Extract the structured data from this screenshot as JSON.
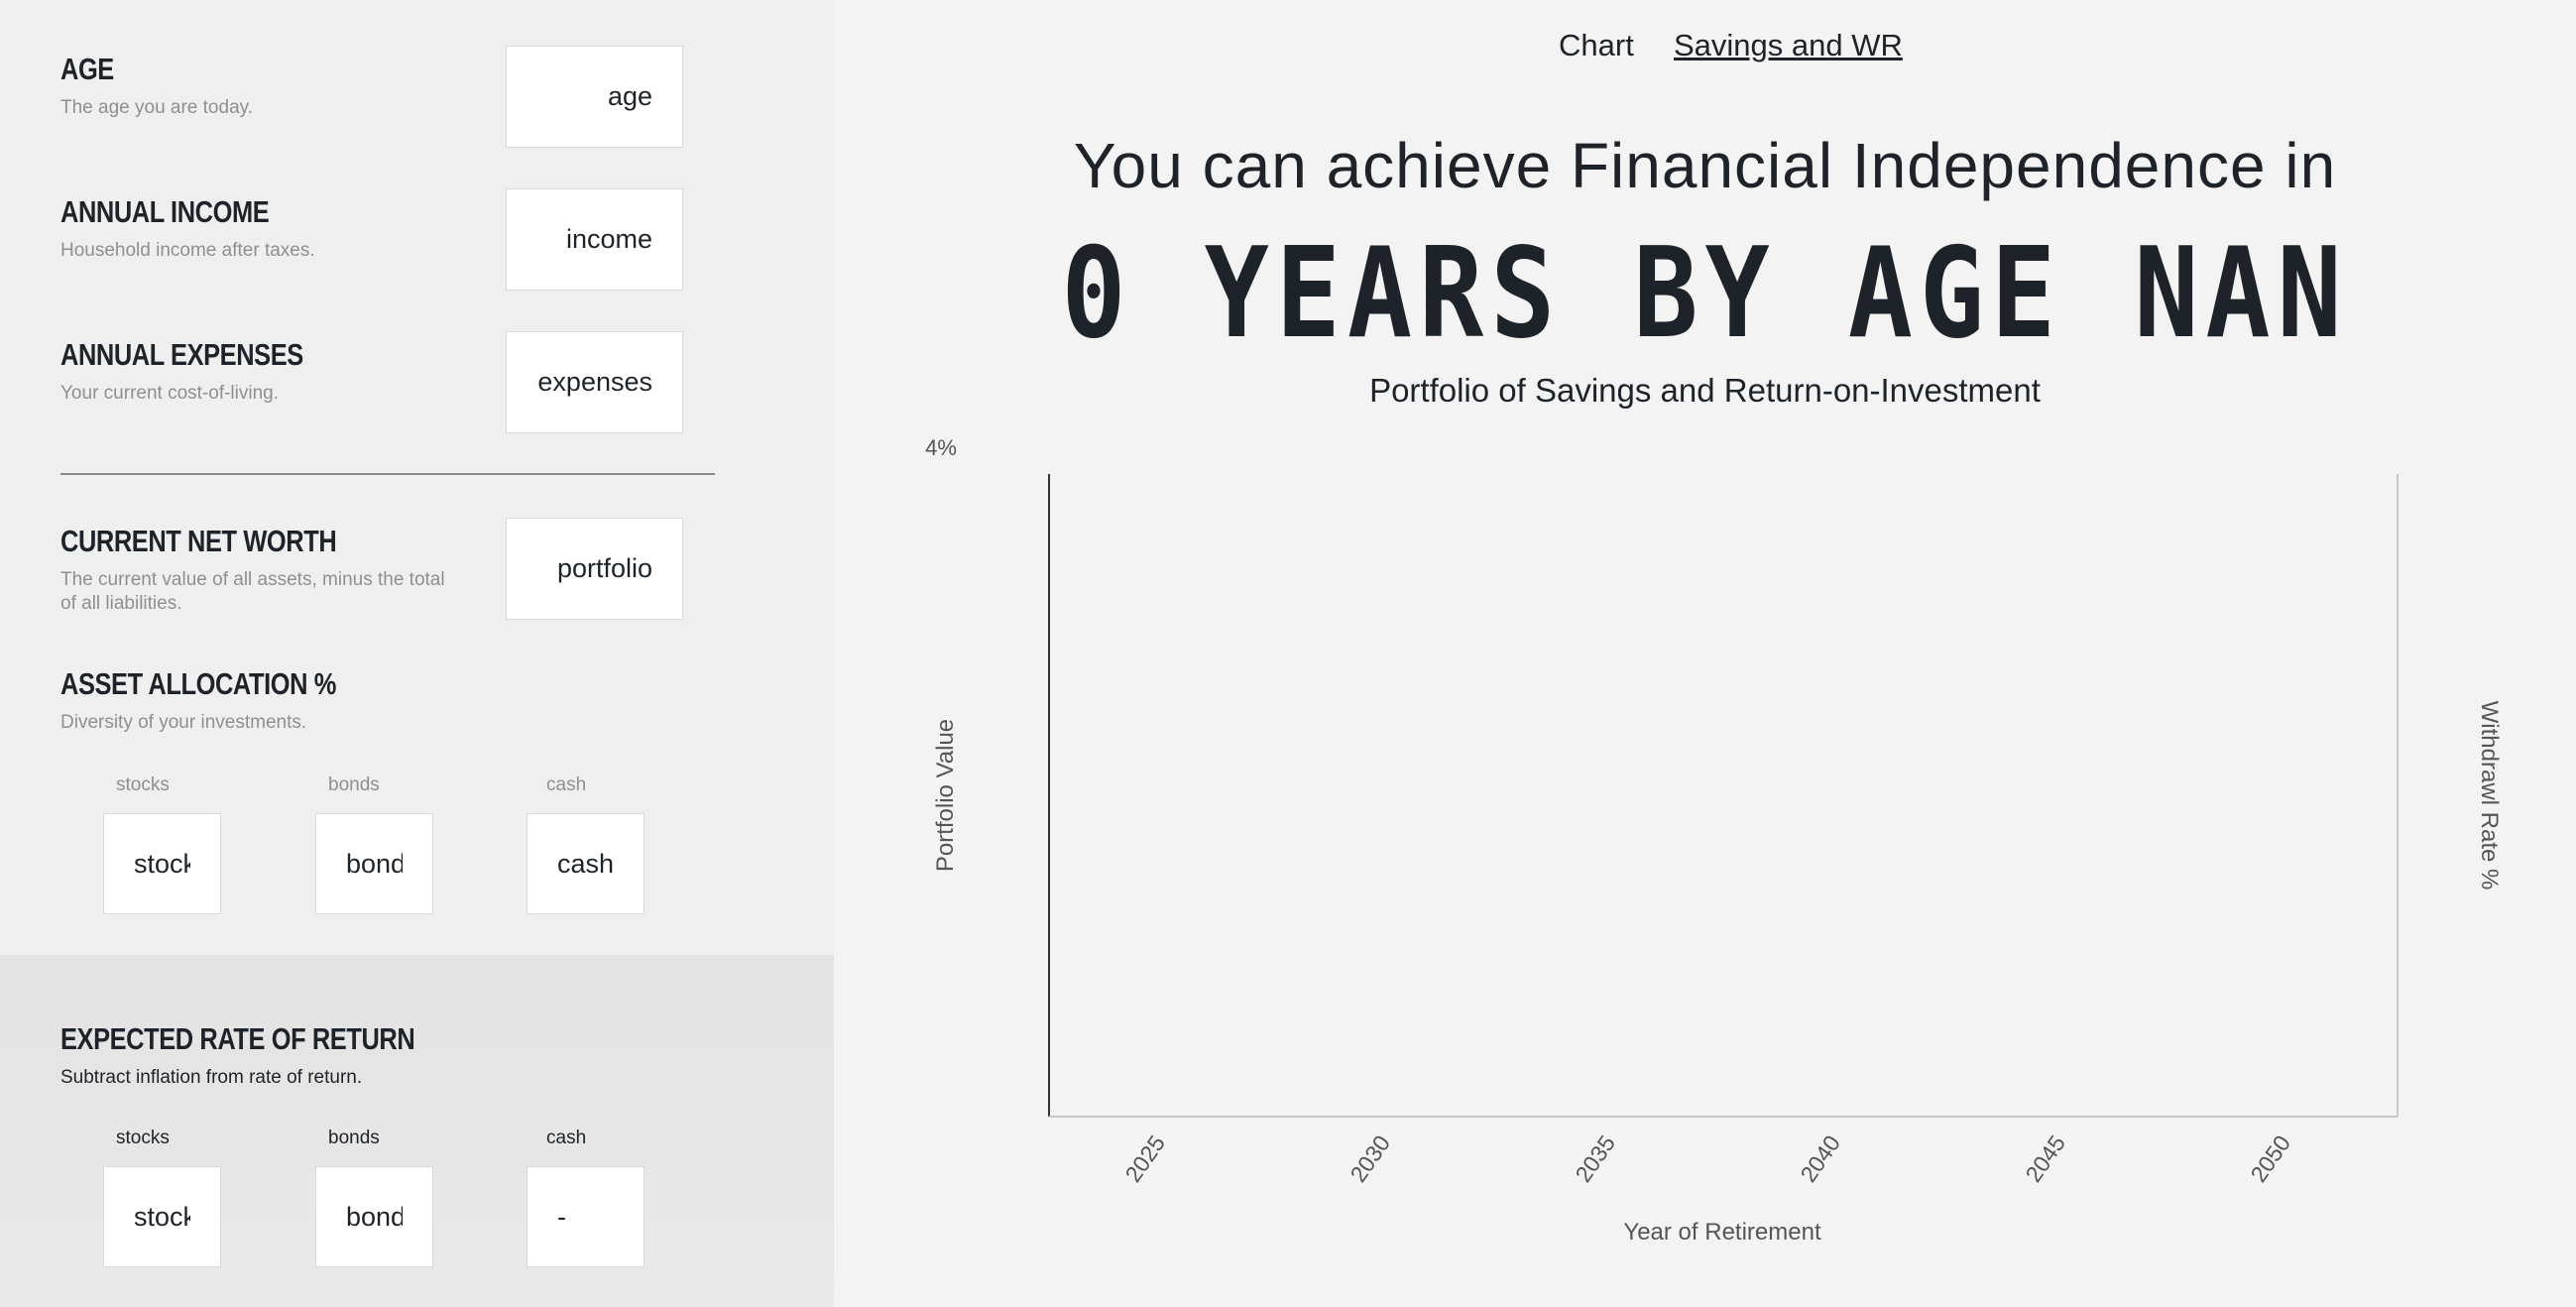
{
  "form": {
    "age": {
      "title": "AGE",
      "desc": "The age you are today.",
      "placeholder": "age"
    },
    "income": {
      "title": "ANNUAL INCOME",
      "desc": "Household income after taxes.",
      "placeholder": "income"
    },
    "expenses": {
      "title": "ANNUAL EXPENSES",
      "desc": "Your current cost-of-living.",
      "placeholder": "expenses"
    },
    "net_worth": {
      "title": "CURRENT NET WORTH",
      "desc": "The current value of all assets, minus the total of all liabilities.",
      "placeholder": "portfolio"
    },
    "allocation": {
      "title": "ASSET ALLOCATION %",
      "desc": "Diversity of your investments.",
      "labels": {
        "stocks": "stocks",
        "bonds": "bonds",
        "cash": "cash"
      },
      "placeholders": {
        "stocks": "stocks",
        "bonds": "bond",
        "cash": "cash"
      }
    },
    "return": {
      "title": "EXPECTED RATE OF RETURN",
      "desc": "Subtract inflation from rate of return.",
      "labels": {
        "stocks": "stocks",
        "bonds": "bonds",
        "cash": "cash"
      },
      "placeholders": {
        "stocks": "stocks",
        "bonds": "bond",
        "cash": "-"
      }
    }
  },
  "nav": {
    "chart": "Chart",
    "savings_wr": "Savings and WR"
  },
  "result": {
    "headline": "You can achieve Financial Independence in",
    "years_line": "0 YEARS BY AGE NAN"
  },
  "chart_data": {
    "type": "line",
    "title": "Portfolio of Savings and Return-on-Investment",
    "xlabel": "Year of Retirement",
    "ylabel": "Portfolio Value",
    "y2label": "Withdrawl Rate %",
    "x_ticks": [
      "2025",
      "2030",
      "2035",
      "2040",
      "2045",
      "2050"
    ],
    "y2_partial_tick": "4%",
    "series": []
  }
}
